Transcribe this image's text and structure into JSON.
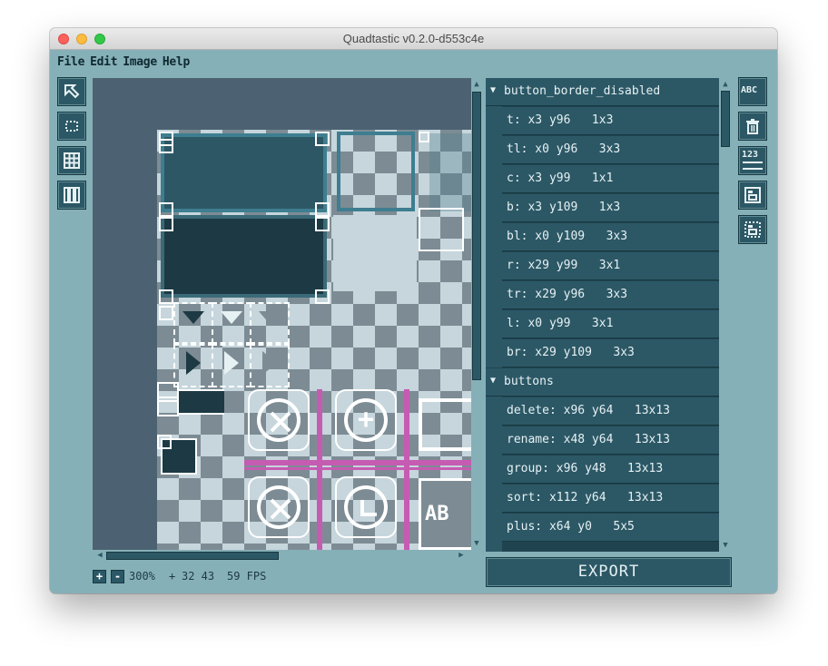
{
  "window": {
    "title": "Quadtastic v0.2.0-d553c4e"
  },
  "menubar": {
    "items": [
      "File",
      "Edit",
      "Image",
      "Help"
    ]
  },
  "tools_left": [
    {
      "name": "select-tool",
      "icon": "cursor-arrow-icon"
    },
    {
      "name": "create-tool",
      "icon": "create-rect-icon"
    },
    {
      "name": "grid-tool",
      "icon": "grid-icon"
    },
    {
      "name": "strip-tool",
      "icon": "strip-icon"
    }
  ],
  "tools_right": [
    {
      "name": "rename-button",
      "icon": "abc-icon",
      "label": "ABC"
    },
    {
      "name": "delete-button",
      "icon": "trash-icon"
    },
    {
      "name": "sort-button",
      "icon": "sort-123-icon",
      "label": "123"
    },
    {
      "name": "group-button",
      "icon": "group-icon"
    },
    {
      "name": "ungroup-button",
      "icon": "ungroup-icon"
    }
  ],
  "canvas": {
    "button_glyphs": [
      "+",
      "AB"
    ]
  },
  "status": {
    "zoom_in": "+",
    "zoom_out": "-",
    "zoom": "300%",
    "cursor_symbol": "+",
    "cursor": "32 43",
    "fps": "59 FPS"
  },
  "quad_groups": [
    {
      "name": "button_border_disabled",
      "quads": [
        "t: x3 y96   1x3",
        "tl: x0 y96   3x3",
        "c: x3 y99   1x1",
        "b: x3 y109   1x3",
        "bl: x0 y109   3x3",
        "r: x29 y99   3x1",
        "tr: x29 y96   3x3",
        "l: x0 y99   3x1",
        "br: x29 y109   3x3"
      ]
    },
    {
      "name": "buttons",
      "quads": [
        "delete: x96 y64   13x13",
        "rename: x48 y64   13x13",
        "group: x96 y48   13x13",
        "sort: x112 y64   13x13",
        "plus: x64 y0   5x5"
      ]
    }
  ],
  "export": {
    "label": "EXPORT"
  },
  "colors": {
    "window_bg": "#86b0b8",
    "button_bg": "#2c5866",
    "canvas_bg": "#4c6272",
    "accent_pink": "#c65bb2",
    "text_light": "#e6f1f3"
  }
}
